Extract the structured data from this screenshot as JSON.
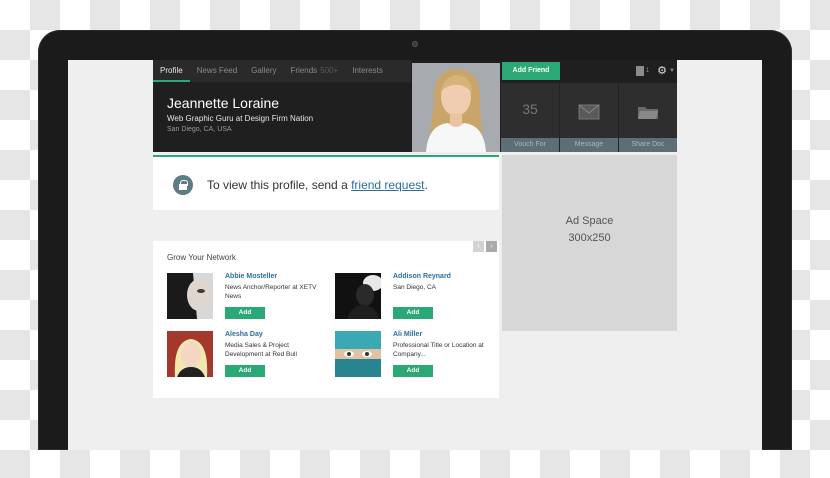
{
  "nav": {
    "tabs": [
      {
        "label": "Profile"
      },
      {
        "label": "News Feed"
      },
      {
        "label": "Gallery"
      },
      {
        "label": "Friends",
        "count": "500+"
      },
      {
        "label": "Interests"
      }
    ]
  },
  "profile": {
    "name": "Jeannette Loraine",
    "title": "Web Graphic Guru at Design Firm Nation",
    "location": "San Diego, CA, USA"
  },
  "header": {
    "add_friend_label": "Add Friend",
    "doc_count": "1",
    "icons": [
      "document-icon",
      "gear-icon",
      "chevron-down-icon"
    ]
  },
  "actions": [
    {
      "label": "Vouch For",
      "value": "35"
    },
    {
      "label": "Message",
      "icon": "envelope-icon"
    },
    {
      "label": "Share Doc",
      "icon": "folder-icon"
    }
  ],
  "lock": {
    "text_before": "To view this profile, send a ",
    "link": "friend request",
    "text_after": "."
  },
  "ad": {
    "line1": "Ad Space",
    "line2": "300x250"
  },
  "network": {
    "title": "Grow Your Network",
    "prev": "‹",
    "next": "›",
    "people": [
      {
        "name": "Abbie Mosteller",
        "desc": "News Anchor/Reporter at XETV News",
        "add": "Add"
      },
      {
        "name": "Addison Reynard",
        "desc": "San Diego, CA",
        "add": "Add"
      },
      {
        "name": "Alesha Day",
        "desc": "Media Sales & Project Development at Red Bull",
        "add": "Add"
      },
      {
        "name": "Ali Miller",
        "desc": "Professional Title or Location at Company...",
        "add": "Add"
      }
    ]
  },
  "colors": {
    "accent": "#2aa876",
    "link": "#2a6f9e",
    "header_bg": "#1f1f1f"
  }
}
